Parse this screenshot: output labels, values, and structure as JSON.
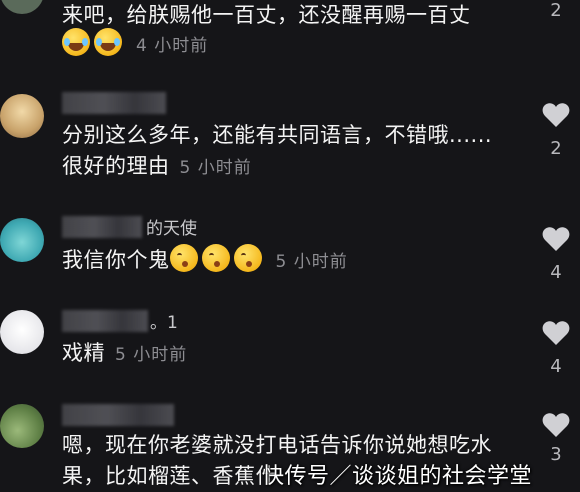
{
  "comments": [
    {
      "text": "来吧，给朕赐他一百丈，还没醒再赐一百丈",
      "emojis": [
        "laugh-cry-emoji",
        "laugh-cry-emoji"
      ],
      "time": "4 小时前",
      "likes": "2"
    },
    {
      "text_line1": "分别这么多年，还能有共同语言，不错哦......",
      "text_line2": "很好的理由",
      "time": "5 小时前",
      "likes": "2"
    },
    {
      "username_partial": "的天使",
      "text": "我信你个鬼",
      "emojis": [
        "kiss-emoji",
        "kiss-emoji",
        "kiss-emoji"
      ],
      "time": "5 小时前",
      "likes": "4"
    },
    {
      "username_partial": "。1",
      "text": "戏精",
      "time": "5 小时前",
      "likes": "4"
    },
    {
      "text_line1": "嗯，现在你老婆就没打电话告诉你说她想吃水",
      "text_line2": "果，比如榴莲、香蕉什",
      "likes": "3"
    }
  ],
  "watermark": "快传号／谈谈姐的社会学堂",
  "colors": {
    "background": "#151518",
    "text": "#f4f4f4",
    "meta": "#8d8d92",
    "heart": "#d0d0d4"
  }
}
